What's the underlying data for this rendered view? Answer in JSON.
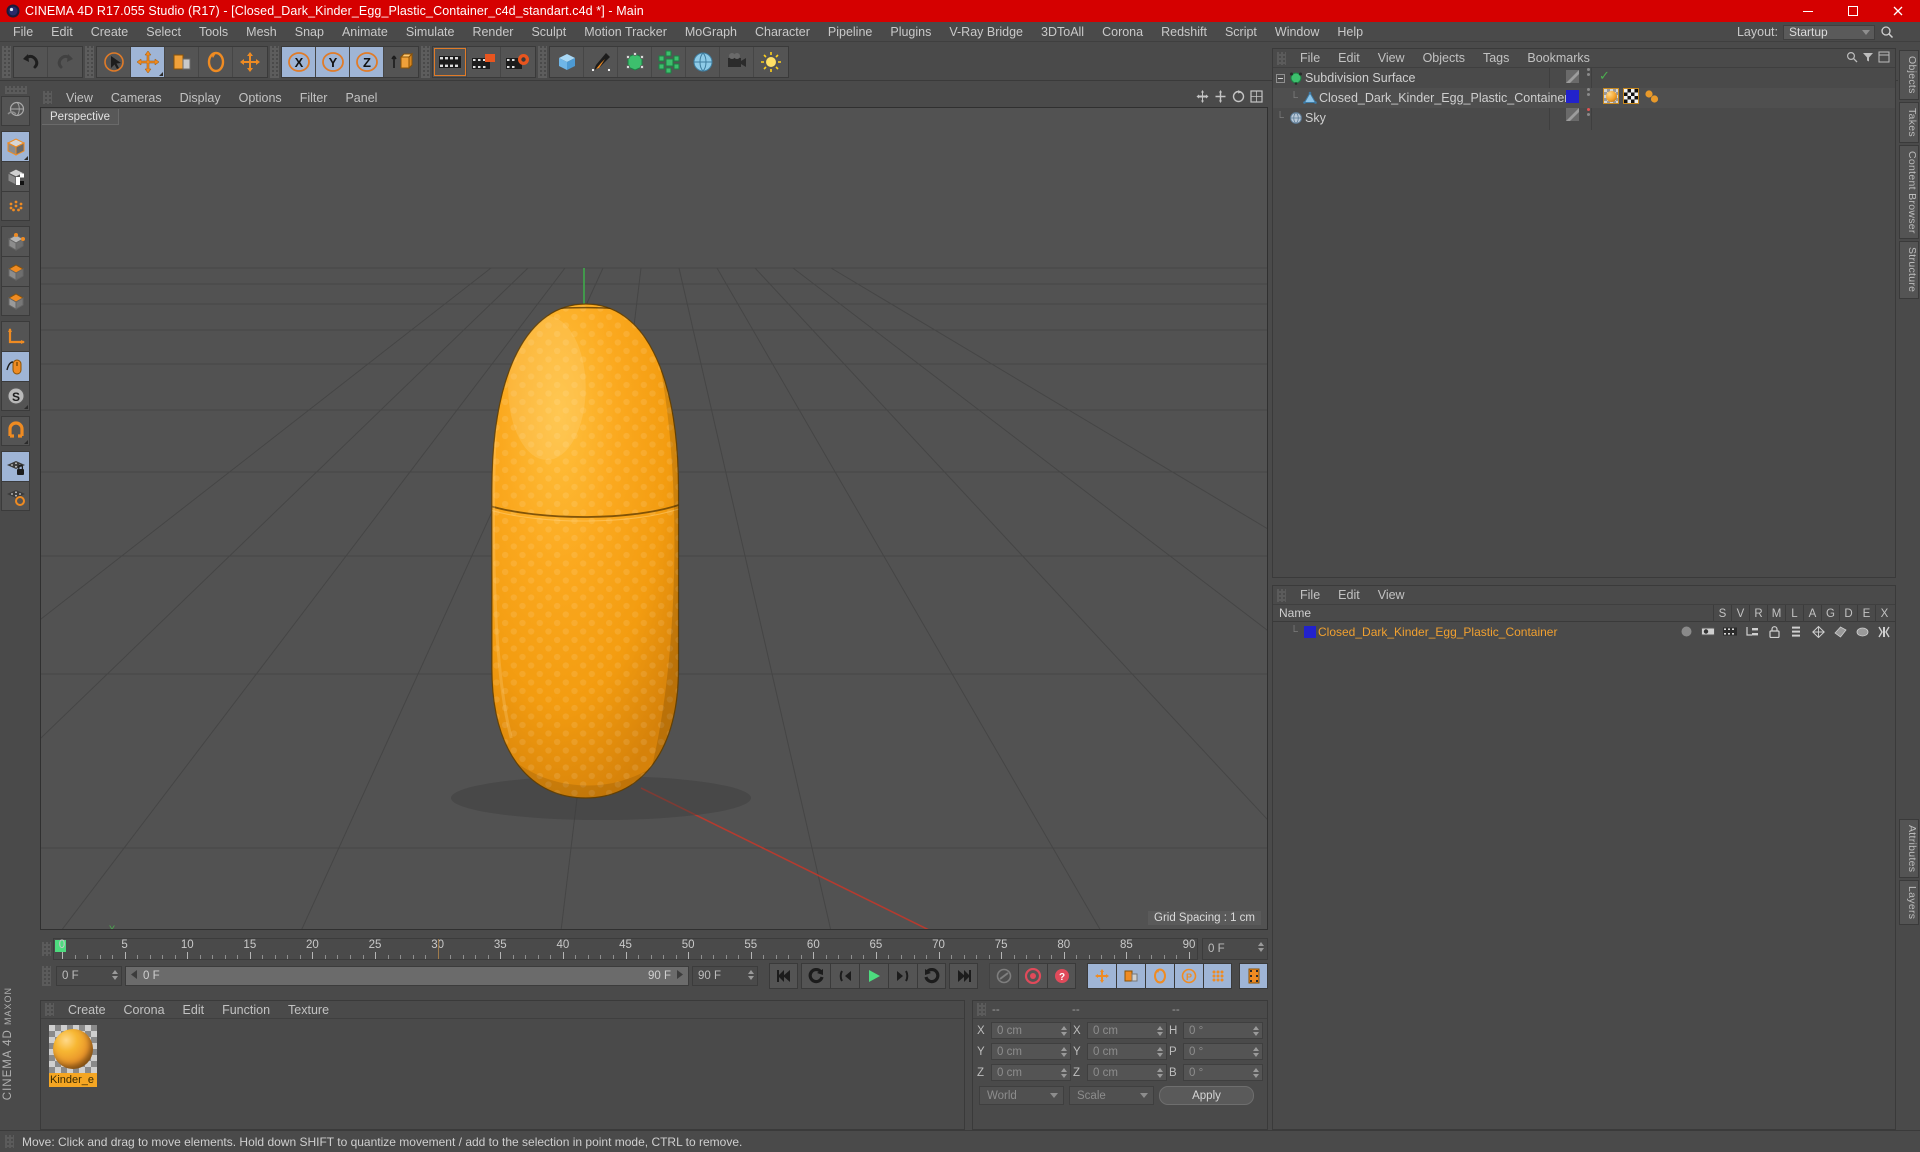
{
  "window": {
    "title": "CINEMA 4D R17.055 Studio (R17) - [Closed_Dark_Kinder_Egg_Plastic_Container_c4d_standart.c4d *] - Main",
    "app_icon": "cinema4d-icon",
    "minimize": "minimize-icon",
    "maximize": "maximize-icon",
    "close": "close-icon",
    "titlebar_color": "#d50000"
  },
  "menubar": {
    "items": [
      "File",
      "Edit",
      "Create",
      "Select",
      "Tools",
      "Mesh",
      "Snap",
      "Animate",
      "Simulate",
      "Render",
      "Sculpt",
      "Motion Tracker",
      "MoGraph",
      "Character",
      "Pipeline",
      "Plugins",
      "V-Ray Bridge",
      "3DToAll",
      "Corona",
      "Redshift",
      "Script",
      "Window",
      "Help"
    ],
    "layout_label": "Layout:",
    "layout_value": "Startup",
    "search_icon": "search-icon"
  },
  "toolbar": {
    "groups": [
      {
        "name": "history",
        "buttons": [
          {
            "icon": "undo-icon",
            "selected": false,
            "dim": false
          },
          {
            "icon": "redo-icon",
            "selected": false,
            "dim": true
          }
        ]
      },
      {
        "name": "transform",
        "buttons": [
          {
            "icon": "live-selection-icon",
            "selected": false,
            "dim": false
          },
          {
            "icon": "move-tool-icon",
            "selected": true,
            "dim": false
          },
          {
            "icon": "scale-tool-icon",
            "selected": false,
            "dim": false
          },
          {
            "icon": "rotate-tool-icon",
            "selected": false,
            "dim": false
          },
          {
            "icon": "axis-move-icon",
            "selected": false,
            "dim": false
          }
        ]
      },
      {
        "name": "axis-lock",
        "buttons": [
          {
            "icon": "lock-x-axis-icon",
            "selected": true,
            "dim": false
          },
          {
            "icon": "lock-y-axis-icon",
            "selected": true,
            "dim": false
          },
          {
            "icon": "lock-z-axis-icon",
            "selected": true,
            "dim": false
          },
          {
            "icon": "world-object-axis-icon",
            "selected": false,
            "dim": false
          }
        ]
      },
      {
        "name": "render",
        "buttons": [
          {
            "icon": "render-view-icon",
            "selected": false,
            "dim": false
          },
          {
            "icon": "render-to-picture-viewer-icon",
            "selected": false,
            "dim": false
          },
          {
            "icon": "render-settings-icon",
            "selected": false,
            "dim": false
          }
        ]
      },
      {
        "name": "create",
        "buttons": [
          {
            "icon": "primitive-cube-icon",
            "selected": false,
            "dim": false
          },
          {
            "icon": "spline-pen-icon",
            "selected": false,
            "dim": false
          },
          {
            "icon": "generator-nurbs-icon",
            "selected": false,
            "dim": false
          },
          {
            "icon": "deformer-icon",
            "selected": false,
            "dim": false
          },
          {
            "icon": "environment-icon",
            "selected": false,
            "dim": false
          },
          {
            "icon": "camera-icon",
            "selected": false,
            "dim": false
          },
          {
            "icon": "light-icon",
            "selected": false,
            "dim": false
          }
        ]
      }
    ]
  },
  "left_toolbar": {
    "buttons": [
      {
        "icon": "undo-view-icon",
        "selected": false
      },
      {
        "icon": "model-mode-icon",
        "selected": true
      },
      {
        "icon": "texture-mode-icon",
        "selected": false
      },
      {
        "icon": "points-mode-icon",
        "selected": false
      },
      {
        "icon": "edges-mode-icon",
        "selected": false
      },
      {
        "icon": "polygons-mode-icon",
        "selected": false
      },
      {
        "icon": "axis-mode-icon",
        "selected": false
      },
      {
        "icon": "object-axis-icon",
        "selected": false
      },
      {
        "icon": "viewport-solo-icon",
        "selected": true
      },
      {
        "icon": "snap-s-icon",
        "selected": true
      },
      {
        "icon": "magnet-icon",
        "selected": false
      },
      {
        "icon": "workplane-lock-icon",
        "selected": true
      },
      {
        "icon": "workplane-icon",
        "selected": false
      }
    ],
    "brand": "CINEMA 4D",
    "brand_sub": "MAXON"
  },
  "viewport": {
    "menu": [
      "View",
      "Cameras",
      "Display",
      "Options",
      "Filter",
      "Panel"
    ],
    "tab_label": "Perspective",
    "grid_spacing": "Grid Spacing : 1 cm",
    "icons": [
      "move-camera-icon",
      "scale-camera-icon",
      "rotate-camera-icon",
      "maximize-view-icon"
    ],
    "background_color": "#525252",
    "object_color": "#f5a623"
  },
  "timeline": {
    "ticks": [
      0,
      5,
      10,
      15,
      20,
      25,
      30,
      35,
      40,
      45,
      50,
      55,
      60,
      65,
      70,
      75,
      80,
      85,
      90
    ],
    "current_frame": "0 F",
    "start_frame": "0 F",
    "end_frame": "90 F",
    "preview_end": "90 F",
    "playhead_frame": 0
  },
  "transport": {
    "buttons": [
      {
        "icon": "go-to-start-icon",
        "selected": false
      },
      {
        "icon": "previous-key-icon",
        "selected": false
      },
      {
        "icon": "step-back-icon",
        "selected": false
      },
      {
        "icon": "play-icon",
        "selected": false
      },
      {
        "icon": "step-forward-icon",
        "selected": false
      },
      {
        "icon": "next-key-icon",
        "selected": false
      },
      {
        "icon": "go-to-end-icon",
        "selected": false
      },
      {
        "icon": "autokey-link-icon",
        "selected": false
      },
      {
        "icon": "record-active-objects-icon",
        "selected": false
      },
      {
        "icon": "autokeying-icon",
        "selected": false
      },
      {
        "icon": "record-position-icon",
        "selected": true
      },
      {
        "icon": "record-scale-icon",
        "selected": true
      },
      {
        "icon": "record-rotation-icon",
        "selected": true
      },
      {
        "icon": "record-parameter-icon",
        "selected": true
      },
      {
        "icon": "record-pla-icon",
        "selected": true
      },
      {
        "icon": "keyframe-selection-icon",
        "selected": true
      }
    ]
  },
  "material_manager": {
    "menu": [
      "Create",
      "Corona",
      "Edit",
      "Function",
      "Texture"
    ],
    "materials": [
      {
        "name": "Kinder_e",
        "swatch_color": "#f5a623",
        "selected": true
      }
    ]
  },
  "coordinates": {
    "header_cells": [
      "--",
      "--",
      "--"
    ],
    "rows": [
      {
        "axis1": "X",
        "value1": "0 cm",
        "axis2": "X",
        "value2": "0 cm",
        "axis3": "H",
        "value3": "0 °"
      },
      {
        "axis1": "Y",
        "value1": "0 cm",
        "axis2": "Y",
        "value2": "0 cm",
        "axis3": "P",
        "value3": "0 °"
      },
      {
        "axis1": "Z",
        "value1": "0 cm",
        "axis2": "Z",
        "value2": "0 cm",
        "axis3": "B",
        "value3": "0 °"
      }
    ],
    "space_select": "World",
    "mode_select": "Scale",
    "apply_label": "Apply"
  },
  "object_manager": {
    "menu": [
      "File",
      "Edit",
      "View",
      "Objects",
      "Tags",
      "Bookmarks"
    ],
    "rows": [
      {
        "name": "Subdivision Surface",
        "icon": "subdivision-surface-icon",
        "depth": 0,
        "enabled_check": "✓",
        "dot_color": "#4caf50",
        "tags": []
      },
      {
        "name": "Closed_Dark_Kinder_Egg_Plastic_Container",
        "icon": "polygon-object-icon",
        "depth": 1,
        "layer_color": "#2222cc",
        "tags": [
          "material-tag-icon",
          "uvw-tag-icon",
          "phong-tag-icon"
        ]
      },
      {
        "name": "Sky",
        "icon": "sky-object-icon",
        "depth": 0,
        "dot_color": "#e05252",
        "tags": []
      }
    ]
  },
  "layer_manager": {
    "menu": [
      "File",
      "Edit",
      "View"
    ],
    "columns": [
      "Name",
      "S",
      "V",
      "R",
      "M",
      "L",
      "A",
      "G",
      "D",
      "E",
      "X"
    ],
    "rows": [
      {
        "name": "Closed_Dark_Kinder_Egg_Plastic_Container",
        "swatch_color": "#2222cc",
        "cells": [
          "solo-dot-icon",
          "visible-icon",
          "render-icon",
          "manager-icon",
          "lock-icon",
          "animation-icon",
          "generators-icon",
          "deformers-icon",
          "expressions-icon",
          "xref-icon"
        ]
      }
    ]
  },
  "right_tabs": [
    "Objects",
    "Takes",
    "Content Browser",
    "Structure",
    "Attributes",
    "Layers"
  ],
  "statusbar": {
    "message": "Move: Click and drag to move elements. Hold down SHIFT to quantize movement / add to the selection in point mode, CTRL to remove."
  }
}
